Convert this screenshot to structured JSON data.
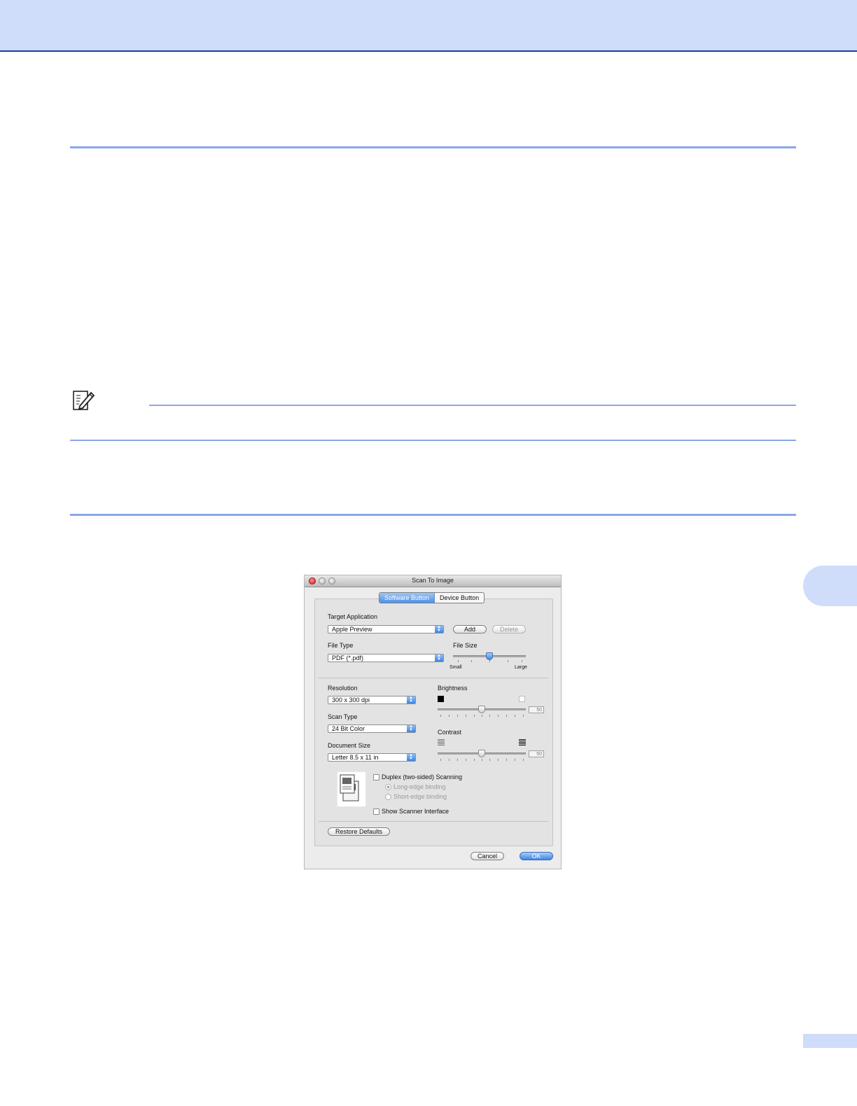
{
  "dialog": {
    "title": "Scan To Image",
    "tabs": [
      "Software Button",
      "Device Button"
    ],
    "target_app_label": "Target Application",
    "target_app_value": "Apple Preview",
    "add_label": "Add",
    "delete_label": "Delete",
    "file_type_label": "File Type",
    "file_type_value": "PDF (*.pdf)",
    "file_size_label": "File Size",
    "file_size_small": "Small",
    "file_size_large": "Large",
    "resolution_label": "Resolution",
    "resolution_value": "300 x 300 dpi",
    "scan_type_label": "Scan Type",
    "scan_type_value": "24 Bit Color",
    "doc_size_label": "Document Size",
    "doc_size_value": "Letter  8.5 x 11 in",
    "brightness_label": "Brightness",
    "brightness_value": "50",
    "contrast_label": "Contrast",
    "contrast_value": "50",
    "duplex_label": "Duplex (two-sided) Scanning",
    "long_edge_label": "Long-edge binding",
    "short_edge_label": "Short-edge binding",
    "show_scanner_label": "Show Scanner Interface",
    "restore_label": "Restore Defaults",
    "cancel_label": "Cancel",
    "ok_label": "OK"
  },
  "colors": {
    "header_band": "#cfdcfa",
    "header_line": "#1c3f94",
    "rule": "#8aa7e8",
    "accent_blue": "#3f86e3"
  }
}
